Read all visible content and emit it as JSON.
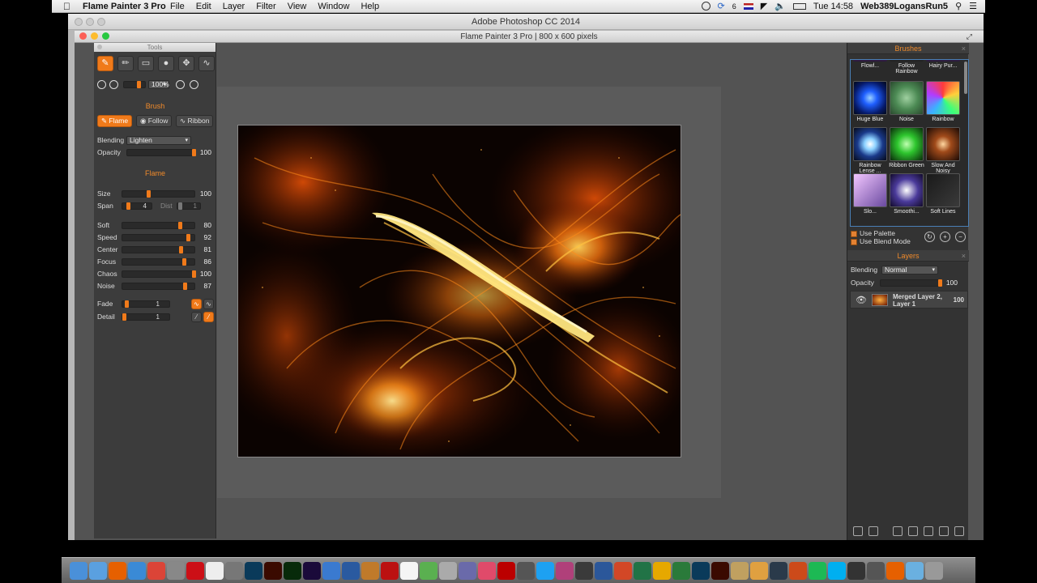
{
  "menubar": {
    "app_name": "Flame Painter 3 Pro",
    "menus": [
      "File",
      "Edit",
      "Layer",
      "Filter",
      "View",
      "Window",
      "Help"
    ],
    "badge_count": "6",
    "clock": "Tue 14:58",
    "user": "Web389LogansRun5"
  },
  "ps_window": {
    "title": "Adobe Photoshop CC 2014"
  },
  "fp_window": {
    "title": "Flame Painter 3 Pro | 800 x 600 pixels"
  },
  "tools_panel": {
    "title": "Tools",
    "zoom": "100%",
    "brush_section": "Brush",
    "modes": [
      "Flame",
      "Follow",
      "Ribbon"
    ],
    "blending_label": "Blending",
    "blending_value": "Lighten",
    "opacity_label": "Opacity",
    "opacity_value": "100",
    "flame_section": "Flame",
    "params": [
      {
        "label": "Size",
        "value": "100",
        "level": 0.35
      },
      {
        "label": "Soft",
        "value": "80",
        "level": 0.8
      },
      {
        "label": "Speed",
        "value": "92",
        "level": 0.92
      },
      {
        "label": "Center",
        "value": "81",
        "level": 0.81
      },
      {
        "label": "Focus",
        "value": "86",
        "level": 0.86
      },
      {
        "label": "Chaos",
        "value": "100",
        "level": 1.0
      },
      {
        "label": "Noise",
        "value": "87",
        "level": 0.87
      }
    ],
    "span_label": "Span",
    "span_value": "4",
    "dist_label": "Dist",
    "dist_value": "1",
    "fade_label": "Fade",
    "fade_value": "1",
    "detail_label": "Detail",
    "detail_value": "1"
  },
  "brushes_panel": {
    "title": "Brushes",
    "brushes": [
      "Flowl...",
      "Follow Rainbow",
      "Hairy Pur...",
      "Huge Blue",
      "Noise",
      "Rainbow",
      "Rainbow Lense ...",
      "Ribbon Green",
      "Slow And Noisy",
      "Slo...",
      "Smoothi...",
      "Soft Lines"
    ],
    "use_palette": "Use Palette",
    "use_blend_mode": "Use Blend Mode"
  },
  "layers_panel": {
    "title": "Layers",
    "blending_label": "Blending",
    "blending_value": "Normal",
    "opacity_label": "Opacity",
    "opacity_value": "100",
    "layer_name": "Merged Layer 2, Layer 1",
    "layer_opacity": "100"
  },
  "dock": {
    "icons": [
      "Finder",
      "Preview",
      "Firefox",
      "Safari",
      "Chrome",
      "Photo Booth",
      "Opera",
      "Calendar",
      "Scripts",
      "Ps",
      "Ai",
      "Dw",
      "Ae",
      "Safari2",
      "Xcode",
      "Lamp",
      "Apple",
      "Notes",
      "Maps",
      "Grid",
      "Settings",
      "iTunes",
      "Acrobat",
      "Editor",
      "Twitter",
      "Instagram",
      "Mail",
      "W",
      "P",
      "X",
      "O",
      "Clip",
      "Ps2",
      "Ai2",
      "Bottle",
      "Palette",
      "Lr",
      "Gear",
      "Spotify",
      "Skype",
      "Game",
      "Orbit",
      "Firefox2",
      "Folder",
      "Trash"
    ]
  }
}
